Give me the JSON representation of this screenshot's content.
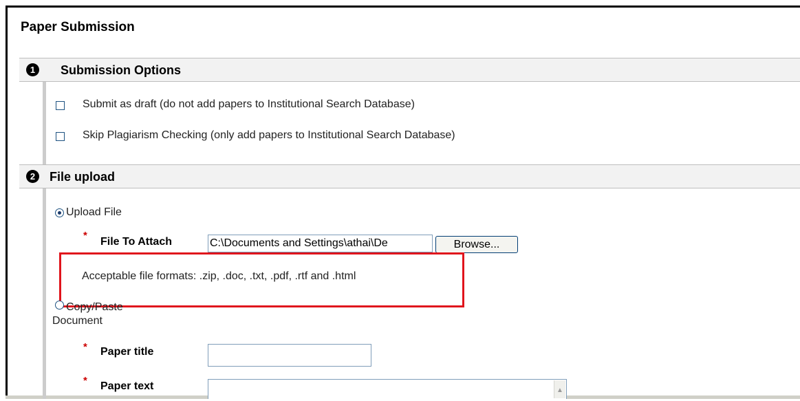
{
  "page": {
    "title": "Paper Submission"
  },
  "sections": {
    "options": {
      "number": "1",
      "title": "Submission Options",
      "checkboxes": [
        {
          "label": "Submit as draft (do not add papers to Institutional Search Database)",
          "checked": false
        },
        {
          "label": "Skip Plagiarism Checking (only add papers to Institutional Search Database)",
          "checked": false
        }
      ]
    },
    "upload": {
      "number": "2",
      "title": "File upload",
      "radio_upload_label": "Upload File",
      "radio_upload_selected": true,
      "file_label": "File To Attach",
      "file_value": "C:\\Documents and Settings\\athai\\De",
      "browse_label": "Browse...",
      "formats_text": "Acceptable file formats: .zip, .doc, .txt, .pdf, .rtf and .html",
      "radio_paste_label": "Copy/Paste",
      "radio_paste_label_2": "Document",
      "paper_title_label": "Paper title",
      "paper_title_value": "",
      "paper_text_label": "Paper text",
      "required_marker": "*"
    }
  },
  "colors": {
    "highlight": "#e0141c",
    "required": "#cc0000",
    "section_bg": "#f2f2f2"
  }
}
